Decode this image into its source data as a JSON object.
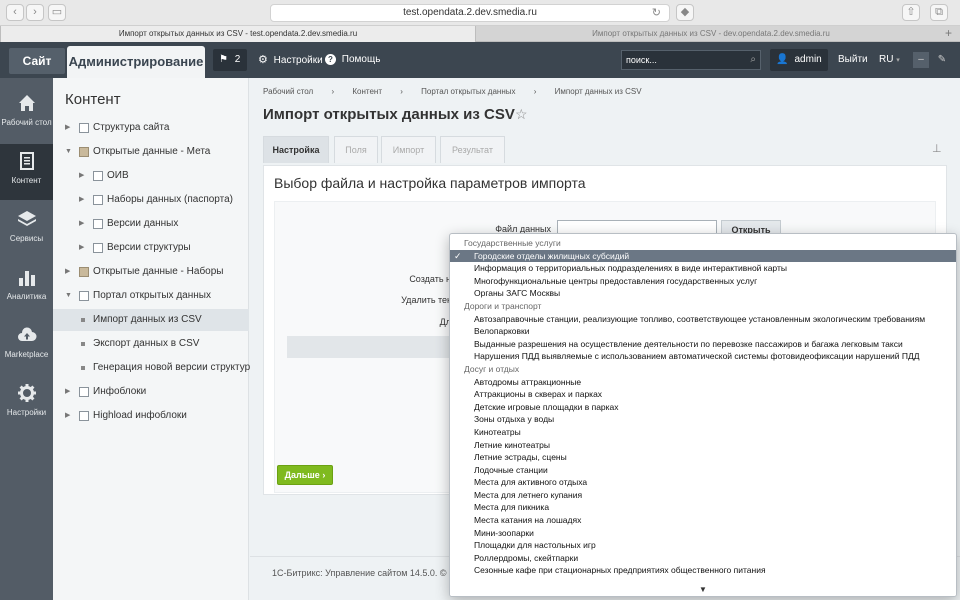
{
  "browser": {
    "url": "test.opendata.2.dev.smedia.ru",
    "tabs": [
      "Импорт открытых данных из CSV - test.opendata.2.dev.smedia.ru",
      "Импорт открытых данных из CSV - dev.opendata.2.dev.smedia.ru"
    ]
  },
  "admin_panel": {
    "site_button": "Сайт",
    "admin_tab": "Администрирование",
    "notifications_count": "2",
    "settings_link": "Настройки",
    "help_link": "Помощь",
    "search_placeholder": "поиск...",
    "user_name": "admin",
    "logout_link": "Выйти",
    "language": "RU"
  },
  "left_nav": [
    {
      "label": "Рабочий стол",
      "icon": "home-icon"
    },
    {
      "label": "Контент",
      "icon": "document-icon"
    },
    {
      "label": "Сервисы",
      "icon": "layers-icon"
    },
    {
      "label": "Аналитика",
      "icon": "bar-chart-icon"
    },
    {
      "label": "Marketplace",
      "icon": "cloud-upload-icon"
    },
    {
      "label": "Настройки",
      "icon": "gear-icon"
    }
  ],
  "tree": {
    "title": "Контент",
    "items": [
      "Структура сайта",
      "Открытые данные - Мета",
      "ОИВ",
      "Наборы данных (паспорта)",
      "Версии данных",
      "Версии структуры",
      "Открытые данные - Наборы",
      "Портал открытых данных",
      "Импорт данных из CSV",
      "Экспорт данных в CSV",
      "Генерация новой версии структуры",
      "Инфоблоки",
      "Highload инфоблоки"
    ]
  },
  "main": {
    "breadcrumbs": [
      "Рабочий стол",
      "Контент",
      "Портал открытых данных",
      "Импорт данных из CSV"
    ],
    "title": "Импорт открытых данных из CSV",
    "tabs": [
      "Настройка",
      "Поля",
      "Импорт",
      "Результат"
    ],
    "section_title": "Выбор файла и настройка параметров импорта",
    "file_label": "Файл данных",
    "open_button": "Открыть",
    "labels": [
      "Создать н",
      "Удалить тек",
      "Дл"
    ],
    "next_button": "Дальше",
    "footer": "1С-Битрикс: Управление сайтом 14.5.0. © 2"
  },
  "dropdown": {
    "groups": [
      {
        "label": "Государственные услуги",
        "options": [
          "Городские отделы жилищных субсидий",
          "Информация о территориальных подразделениях в виде интерактивной карты",
          "Многофункциональные центры предоставления государственных услуг",
          "Органы ЗАГС Москвы"
        ]
      },
      {
        "label": "Дороги и транспорт",
        "options": [
          "Автозаправочные станции, реализующие топливо, соответствующее установленным экологическим требованиям",
          "Велопарковки",
          "Выданные разрешения на осуществление деятельности по перевозке пассажиров и багажа легковым такси",
          "Нарушения ПДД выявляемые с использованием автоматической системы фотовидеофиксации нарушений ПДД"
        ]
      },
      {
        "label": "Досуг и отдых",
        "options": [
          "Автодромы аттракционные",
          "Аттракционы в скверах и парках",
          "Детские игровые площадки в парках",
          "Зоны отдыха у воды",
          "Кинотеатры",
          "Летние кинотеатры",
          "Летние эстрады, сцены",
          "Лодочные станции",
          "Места для активного отдыха",
          "Места для летнего купания",
          "Места для пикника",
          "Места катания на лошадях",
          "Мини-зоопарки",
          "Площадки для настольных игр",
          "Роллердромы, скейтпарки",
          "Сезонные кафе при стационарных предприятиях общественного питания"
        ]
      }
    ],
    "selected": "Городские отделы жилищных субсидий"
  }
}
